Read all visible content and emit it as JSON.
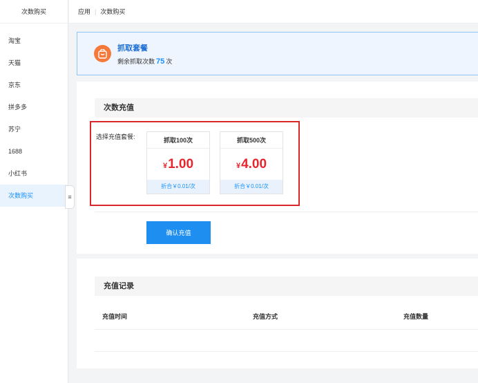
{
  "sidebar": {
    "title": "次数购买",
    "items": [
      {
        "label": "淘宝"
      },
      {
        "label": "天猫"
      },
      {
        "label": "京东"
      },
      {
        "label": "拼多多"
      },
      {
        "label": "苏宁"
      },
      {
        "label": "1688"
      },
      {
        "label": "小红书"
      },
      {
        "label": "次数购买"
      }
    ],
    "collapse_icon": "menu-icon",
    "collapse_glyph": "≡"
  },
  "breadcrumb": {
    "root": "应用",
    "current": "次数购买"
  },
  "notice": {
    "title": "抓取套餐",
    "remaining_label": "剩余抓取次数",
    "remaining_count": "75",
    "remaining_unit": "次",
    "icon": "bag-icon",
    "icon_color": "#f5793b"
  },
  "recharge": {
    "section_title": "次数充值",
    "select_label": "选择充值套餐:",
    "packages": [
      {
        "title": "抓取100次",
        "currency": "¥",
        "price": "1.00",
        "rate": "折合￥0.01/次"
      },
      {
        "title": "抓取500次",
        "currency": "¥",
        "price": "4.00",
        "rate": "折合￥0.01/次"
      }
    ],
    "confirm_label": "确认充值"
  },
  "records": {
    "section_title": "充值记录",
    "columns": [
      "充值时间",
      "充值方式",
      "充值数量"
    ]
  },
  "colors": {
    "accent": "#1890ff",
    "price": "#e5262e",
    "highlight_border": "#d9262c",
    "button": "#1e8ef0"
  }
}
